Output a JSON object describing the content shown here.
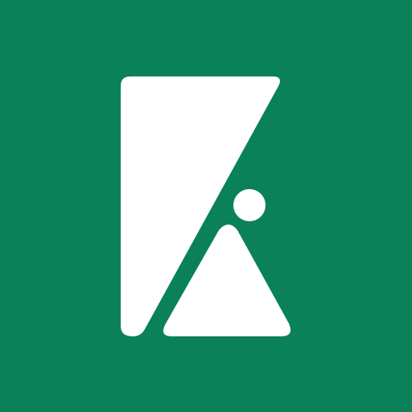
{
  "icon": {
    "name": "app-logo-icon",
    "background_color": "#0A8159",
    "foreground_color": "#FFFFFF"
  }
}
